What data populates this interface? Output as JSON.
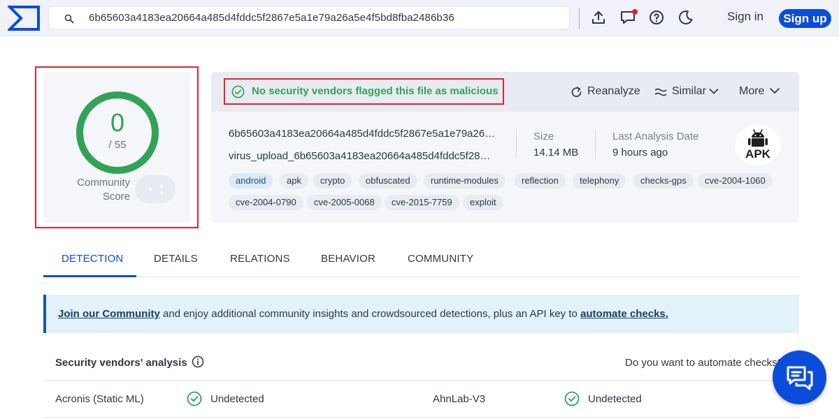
{
  "header": {
    "search_value": "6b65603a4183ea20664a485d4fddc5f2867e5a1e79a26a5e4f5bd8fba2486b36",
    "signin_label": "Sign in",
    "signup_label": "Sign up"
  },
  "score": {
    "detections": "0",
    "total": "/ 55",
    "community_label": "Community\nScore",
    "community_label_line1": "Community",
    "community_label_line2": "Score"
  },
  "file": {
    "verdict": "No security vendors flagged this file as malicious",
    "reanalyze_label": "Reanalyze",
    "similar_label": "Similar",
    "more_label": "More",
    "hash_display": "6b65603a4183ea20664a485d4fddc5f2867e5a1e79a26…",
    "name_display": "virus_upload_6b65603a4183ea20664a485d4fddc5f28…",
    "size_label": "Size",
    "size_value": "14.14 MB",
    "last_analysis_label": "Last Analysis Date",
    "last_analysis_value": "9 hours ago",
    "file_type": "APK",
    "tags": [
      "android",
      "apk",
      "crypto",
      "obfuscated",
      "runtime-modules",
      "reflection",
      "telephony",
      "checks-gps",
      "cve-2004-1060",
      "cve-2004-0790",
      "cve-2005-0068",
      "cve-2015-7759",
      "exploit"
    ]
  },
  "tabs": [
    "DETECTION",
    "DETAILS",
    "RELATIONS",
    "BEHAVIOR",
    "COMMUNITY"
  ],
  "banner": {
    "link1": "Join our Community",
    "text": " and enjoy additional community insights and crowdsourced detections, plus an API key to ",
    "link2": "automate checks."
  },
  "vendors": {
    "title": "Security vendors' analysis",
    "automate_prompt": "Do you want to automate checks?",
    "rows": [
      {
        "name": "Acronis (Static ML)",
        "result": "Undetected"
      },
      {
        "name": "AhnLab-V3",
        "result": "Undetected"
      }
    ]
  },
  "colors": {
    "accent": "#0b4dda",
    "clean": "#31a354",
    "highlight_box": "#e0242d"
  }
}
